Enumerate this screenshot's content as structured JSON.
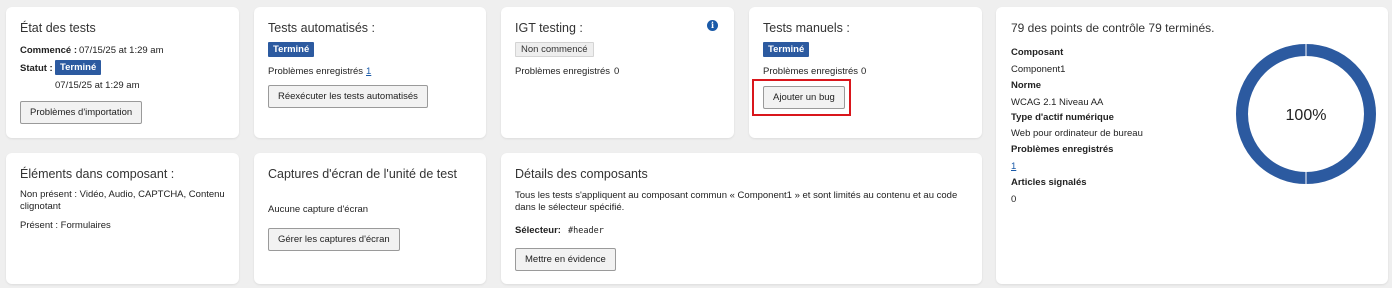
{
  "etat": {
    "title": "État des tests",
    "commence_label": "Commencé :",
    "commence_value": "07/15/25 at 1:29 am",
    "statut_label": "Statut :",
    "statut_badge": "Terminé",
    "statut_date": "07/15/25 at 1:29 am",
    "import_button": "Problèmes d'importation"
  },
  "auto": {
    "title": "Tests automatisés :",
    "badge": "Terminé",
    "problems_label": "Problèmes enregistrés",
    "problems_count": "1",
    "rerun_button": "Réexécuter les tests automatisés"
  },
  "igt": {
    "title": "IGT testing :",
    "badge": "Non commencé",
    "problems_label": "Problèmes enregistrés",
    "problems_count": "0",
    "info_icon": "info-icon"
  },
  "manual": {
    "title": "Tests manuels :",
    "badge": "Terminé",
    "problems_label": "Problèmes enregistrés",
    "problems_count": "0",
    "add_bug_button": "Ajouter un bug",
    "highlight_color": "#d9161c"
  },
  "summary": {
    "headline": "79 des points de contrôle 79 terminés.",
    "composant_label": "Composant",
    "composant_value": "Component1",
    "norme_label": "Norme",
    "norme_value": "WCAG 2.1 Niveau AA",
    "type_label": "Type d'actif numérique",
    "type_value": "Web pour ordinateur de bureau",
    "problems_label": "Problèmes enregistrés",
    "problems_count": "1",
    "articles_label": "Articles signalés",
    "articles_count": "0",
    "progress_text": "100%",
    "progress_fraction": 1.0,
    "ring_color": "#2c5aa0"
  },
  "elements": {
    "title": "Éléments dans composant :",
    "absent_text": "Non présent : Vidéo, Audio, CAPTCHA, Contenu clignotant",
    "present_text": "Présent : Formulaires"
  },
  "captures": {
    "title": "Captures d'écran de l'unité de test",
    "empty_text": "Aucune capture d'écran",
    "manage_button": "Gérer les captures d'écran"
  },
  "details": {
    "title": "Détails des composants",
    "description": "Tous les tests s'appliquent au composant commun « Component1 » et sont limités au contenu et au code dans le sélecteur spécifié.",
    "selector_label": "Sélecteur:",
    "selector_value": "#header",
    "highlight_button": "Mettre en évidence"
  },
  "colors": {
    "accent": "#2c5aa0",
    "background": "#efefef"
  }
}
